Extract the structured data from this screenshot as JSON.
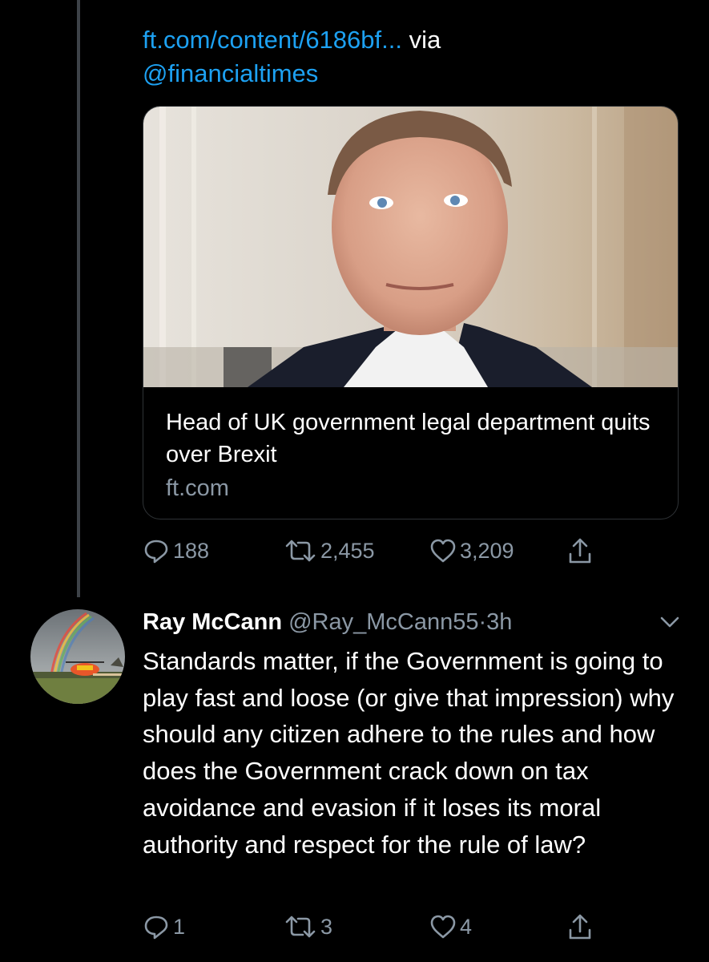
{
  "shared_tweet": {
    "link_text": "ft.com/content/6186bf...",
    "via_text": "via",
    "via_handle": "@financialtimes",
    "card": {
      "title": "Head of UK government legal department quits over Brexit",
      "domain": "ft.com"
    },
    "actions": {
      "replies": "188",
      "retweets": "2,455",
      "likes": "3,209"
    }
  },
  "reply": {
    "name": "Ray McCann",
    "handle": "@Ray_McCann55",
    "separator": "·",
    "time": "3h",
    "text": "Standards matter, if the Government is going to play fast and loose (or give that impression) why should any citizen adhere to the rules and how does the Government crack down on tax avoidance and evasion if it loses its moral authority and respect for the rule of law?",
    "actions": {
      "replies": "1",
      "retweets": "3",
      "likes": "4"
    }
  },
  "colors": {
    "background": "#000000",
    "link": "#1da1f2",
    "muted": "#8b98a5",
    "thread_line": "#3d4248"
  },
  "icons": [
    "reply-icon",
    "retweet-icon",
    "like-icon",
    "share-icon",
    "chevron-down-icon"
  ]
}
